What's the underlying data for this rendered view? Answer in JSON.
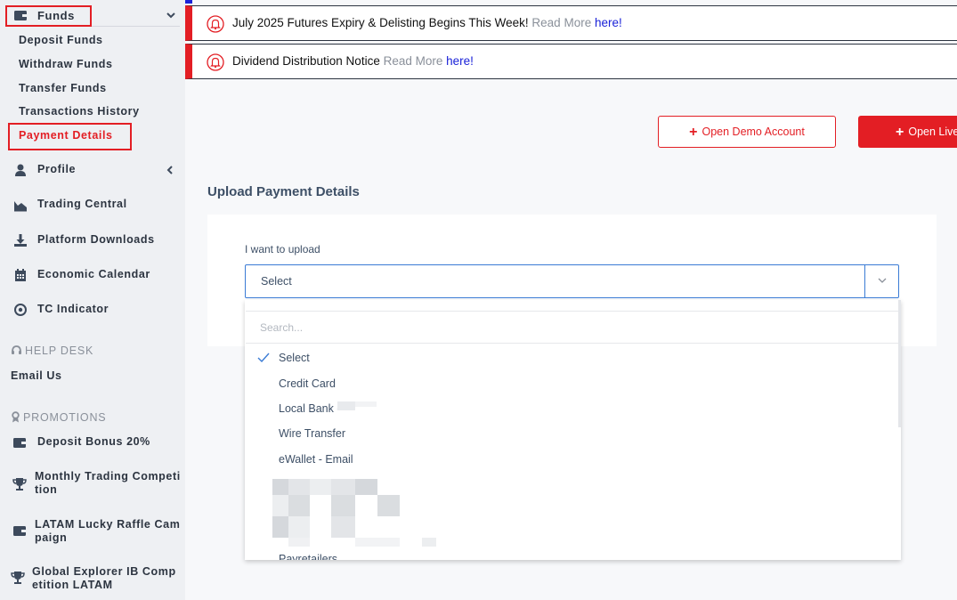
{
  "sidebar": {
    "funds_label": "Funds",
    "funds_sub": [
      "Deposit Funds",
      "Withdraw Funds",
      "Transfer Funds",
      "Transactions History",
      "Payment Details"
    ],
    "nav": [
      "Profile",
      "Trading Central",
      "Platform Downloads",
      "Economic Calendar",
      "TC Indicator"
    ],
    "help_desk_heading": "HELP DESK",
    "email_us": "Email Us",
    "promotions_heading": "PROMOTIONS",
    "promotions": [
      "Deposit Bonus 20%",
      "Monthly Trading Competition",
      "LATAM Lucky Raffle Campaign",
      "Global Explorer IB Competition LATAM"
    ]
  },
  "notices": [
    {
      "title": "July 2025 Futures Expiry & Delisting Begins This Week!",
      "read_more": "Read More",
      "link": "here!"
    },
    {
      "title": "Dividend Distribution Notice",
      "read_more": "Read More",
      "link": "here!"
    }
  ],
  "buttons": {
    "demo": "Open Demo Account",
    "live": "Open Live"
  },
  "upload": {
    "title": "Upload Payment Details",
    "field_label": "I want to upload",
    "selected": "Select",
    "search_placeholder": "Search...",
    "options": [
      "Select",
      "Credit Card",
      "Local Bank -",
      "Wire Transfer",
      "eWallet - Email",
      "Payretailers"
    ]
  },
  "colors": {
    "accent": "#e31e24",
    "text": "#2c3440",
    "link": "#1a22d8",
    "field_border": "#3a7bd5"
  }
}
